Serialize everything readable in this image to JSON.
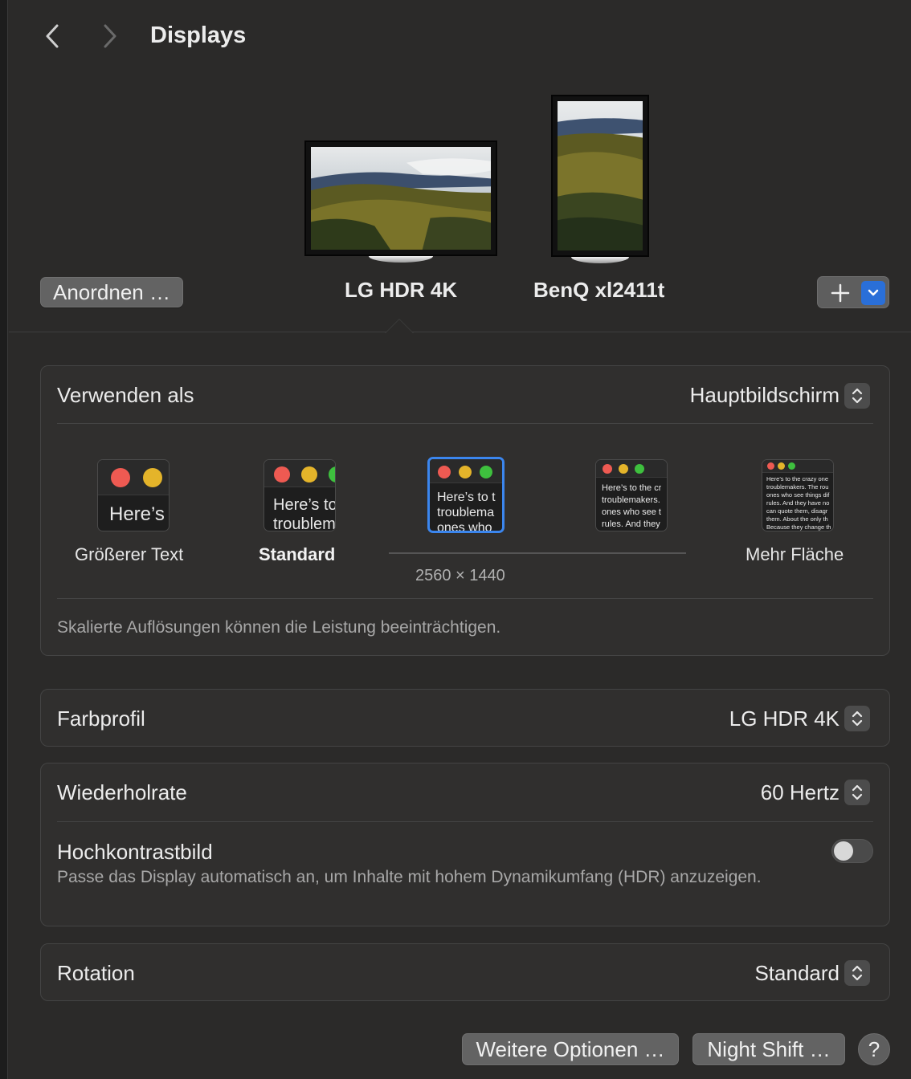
{
  "header": {
    "title": "Displays"
  },
  "arrangement": {
    "arrange_label": "Anordnen …",
    "displays": [
      {
        "name": "LG HDR 4K",
        "selected": true
      },
      {
        "name": "BenQ xl2411t",
        "selected": false
      }
    ],
    "add_label": "+"
  },
  "use_as": {
    "label": "Verwenden als",
    "value": "Hauptbildschirm"
  },
  "scaling": {
    "options": [
      {
        "label": "Größerer Text",
        "preview": "Here’s"
      },
      {
        "label": "Standard",
        "preview": "Here’s to\ntroublem"
      },
      {
        "label": "",
        "preview": "Here’s to t\ntroublema\nones who"
      },
      {
        "label": "",
        "preview": "Here’s to the cr\ntroublemakers.\nones who see t\nrules. And they"
      },
      {
        "label": "Mehr Fläche",
        "preview": "Here’s to the crazy one\ntroublemakers. The rou\nones who see things dif\nrules. And they have no\ncan quote them, disagr\nthem. About the only th\nBecause they change th"
      }
    ],
    "selected_index": 2,
    "resolution": "2560 × 1440",
    "note": "Skalierte Auflösungen können die Leistung beeinträchtigen."
  },
  "color_profile": {
    "label": "Farbprofil",
    "value": "LG HDR 4K"
  },
  "refresh_rate": {
    "label": "Wiederholrate",
    "value": "60 Hertz"
  },
  "hdr": {
    "label": "Hochkontrastbild",
    "description": "Passe das Display automatisch an, um Inhalte mit hohem Dynamikumfang (HDR) anzuzeigen.",
    "enabled": false
  },
  "rotation": {
    "label": "Rotation",
    "value": "Standard"
  },
  "footer": {
    "more_options_label": "Weitere Optionen …",
    "night_shift_label": "Night Shift …",
    "help_label": "?"
  },
  "colors": {
    "accent": "#2a6fd8",
    "selection_border": "#3b86ee",
    "traffic_red": "#ee5a52",
    "traffic_yellow": "#e4b42a",
    "traffic_green": "#3ec03e"
  }
}
